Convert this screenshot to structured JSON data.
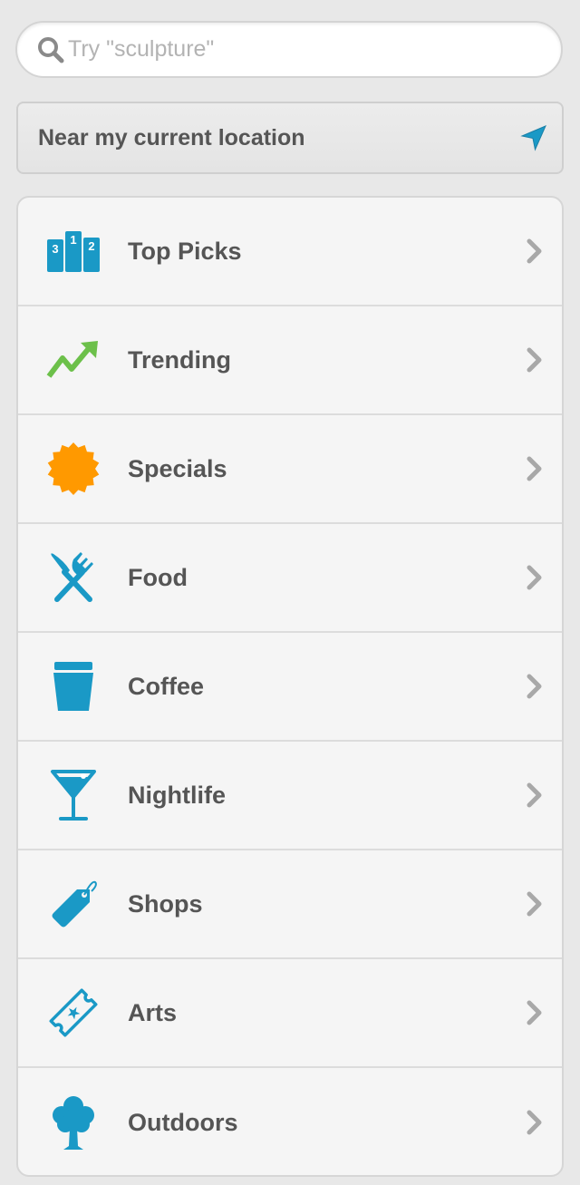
{
  "search": {
    "placeholder": "Try \"sculpture\""
  },
  "location": {
    "label": "Near my current location",
    "icon": "location-arrow-icon"
  },
  "colors": {
    "accent_blue": "#1a99c6",
    "trending_green": "#6cc04a",
    "specials_orange": "#ff9900",
    "text_gray": "#555555"
  },
  "categories": [
    {
      "label": "Top Picks",
      "icon": "podium-icon"
    },
    {
      "label": "Trending",
      "icon": "trending-arrow-icon"
    },
    {
      "label": "Specials",
      "icon": "starburst-icon"
    },
    {
      "label": "Food",
      "icon": "fork-knife-icon"
    },
    {
      "label": "Coffee",
      "icon": "coffee-cup-icon"
    },
    {
      "label": "Nightlife",
      "icon": "martini-glass-icon"
    },
    {
      "label": "Shops",
      "icon": "price-tag-icon"
    },
    {
      "label": "Arts",
      "icon": "ticket-icon"
    },
    {
      "label": "Outdoors",
      "icon": "tree-icon"
    }
  ]
}
